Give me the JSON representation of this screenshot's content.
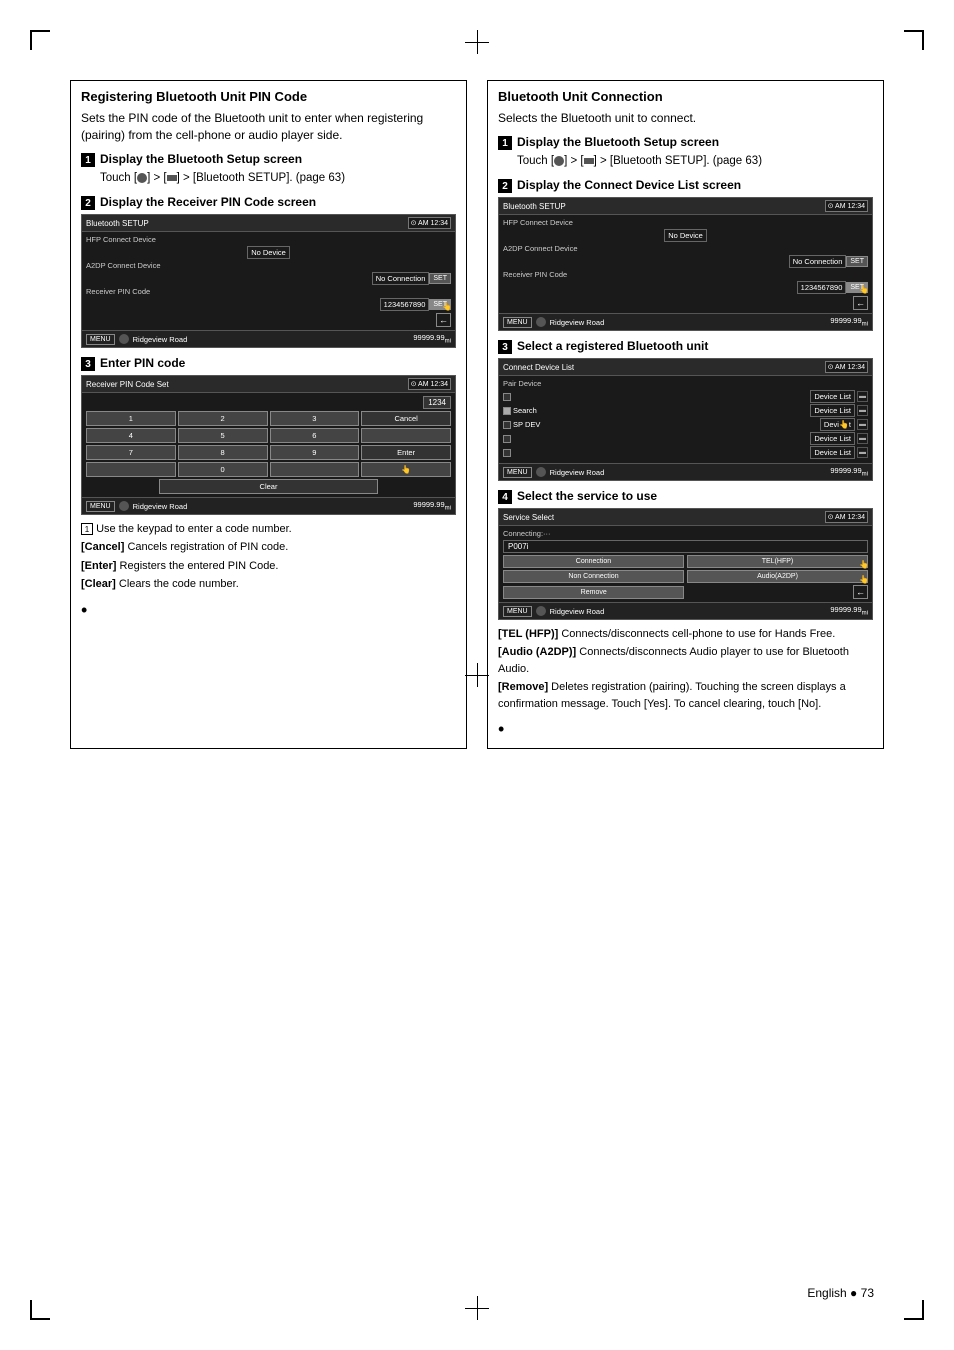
{
  "page": {
    "number": "73",
    "language": "English"
  },
  "left_section": {
    "title": "Registering Bluetooth Unit PIN Code",
    "description": "Sets the PIN code of the Bluetooth unit to enter when registering (pairing) from the cell-phone or audio player side.",
    "steps": [
      {
        "num": "1",
        "title": "Display the Bluetooth Setup screen",
        "body": "Touch [⊙] > [→] > [Bluetooth SETUP]. (page 63)"
      },
      {
        "num": "2",
        "title": "Display the Receiver PIN Code screen",
        "screen": {
          "title": "Bluetooth SETUP",
          "hfp_label": "HFP Connect Device",
          "hfp_value": "No Device",
          "a2dp_label": "A2DP Connect Device",
          "a2dp_value": "No Connection",
          "a2dp_btn": "SET",
          "pin_label": "Receiver PIN Code",
          "pin_value": "1234567890",
          "pin_btn": "SET",
          "footer_menu": "MENU",
          "footer_road": "Ridgeview Road",
          "footer_price": "99999.99"
        }
      },
      {
        "num": "3",
        "title": "Enter PIN code",
        "screen": {
          "title": "Receiver PIN Code Set",
          "display_value": "1234",
          "keys": [
            "1",
            "2",
            "3",
            "Cancel",
            "4",
            "5",
            "6",
            "",
            "7",
            "8",
            "9",
            "Enter",
            "",
            "0",
            "",
            "Clear"
          ],
          "footer_menu": "MENU",
          "footer_road": "Ridgeview Road",
          "footer_price": "99999.99"
        },
        "desc_items": [
          {
            "prefix": "①",
            "text": " Use the keypad to enter a code number."
          },
          {
            "prefix": "[Cancel]",
            "text": "  Cancels registration of PIN code."
          },
          {
            "prefix": "[Enter]",
            "text": "  Registers the entered PIN Code."
          },
          {
            "prefix": "[Clear]",
            "text": "  Clears the code number."
          }
        ]
      }
    ]
  },
  "right_section": {
    "title": "Bluetooth Unit Connection",
    "description": "Selects the Bluetooth unit to connect.",
    "steps": [
      {
        "num": "1",
        "title": "Display the Bluetooth Setup screen",
        "body": "Touch [⊙] > [→] > [Bluetooth SETUP]. (page 63)"
      },
      {
        "num": "2",
        "title": "Display the Connect Device List screen",
        "screen": {
          "title": "Bluetooth SETUP",
          "hfp_label": "HFP Connect Device",
          "hfp_value": "No Device",
          "a2dp_label": "A2DP Connect Device",
          "a2dp_value": "No Connection",
          "a2dp_btn": "SET",
          "pin_label": "Receiver PIN Code",
          "pin_value": "1234567890",
          "pin_btn": "SET",
          "footer_menu": "MENU",
          "footer_road": "Ridgeview Road",
          "footer_price": "99999.99"
        }
      },
      {
        "num": "3",
        "title": "Select a registered Bluetooth unit",
        "screen": {
          "title": "Connect Device List",
          "sub_title": "Pair Device",
          "rows": [
            {
              "label": "",
              "device": "Device List",
              "btn": ""
            },
            {
              "label": "Search",
              "device": "Device List",
              "btn": ""
            },
            {
              "label": "SP DEV",
              "device": "Device List",
              "btn": ""
            },
            {
              "label": "",
              "device": "Device List",
              "btn": ""
            },
            {
              "label": "",
              "device": "Device List",
              "btn": ""
            }
          ],
          "footer_menu": "MENU",
          "footer_road": "Ridgeview Road",
          "footer_price": "99999.99"
        }
      },
      {
        "num": "4",
        "title": "Select the service to use",
        "screen": {
          "title": "Service Select",
          "connecting": "Connecting:···",
          "device": "P007i",
          "connection_btn": "Connection",
          "tel_btn": "TEL(HFP)",
          "non_connection_btn": "Non Connection",
          "audio_btn": "Audio(A2DP)",
          "remove_btn": "Remove",
          "footer_menu": "MENU",
          "footer_road": "Ridgeview Road",
          "footer_price": "99999.99"
        },
        "desc_items": [
          {
            "prefix": "[TEL (HFP)]",
            "text": "  Connects/disconnects cell-phone to use for Hands Free."
          },
          {
            "prefix": "[Audio (A2DP)]",
            "text": "  Connects/disconnects Audio player to use for Bluetooth Audio."
          },
          {
            "prefix": "[Remove]",
            "text": "  Deletes registration (pairing). Touching the screen displays a confirmation message. Touch [Yes]. To cancel clearing, touch [No]."
          }
        ]
      }
    ]
  }
}
